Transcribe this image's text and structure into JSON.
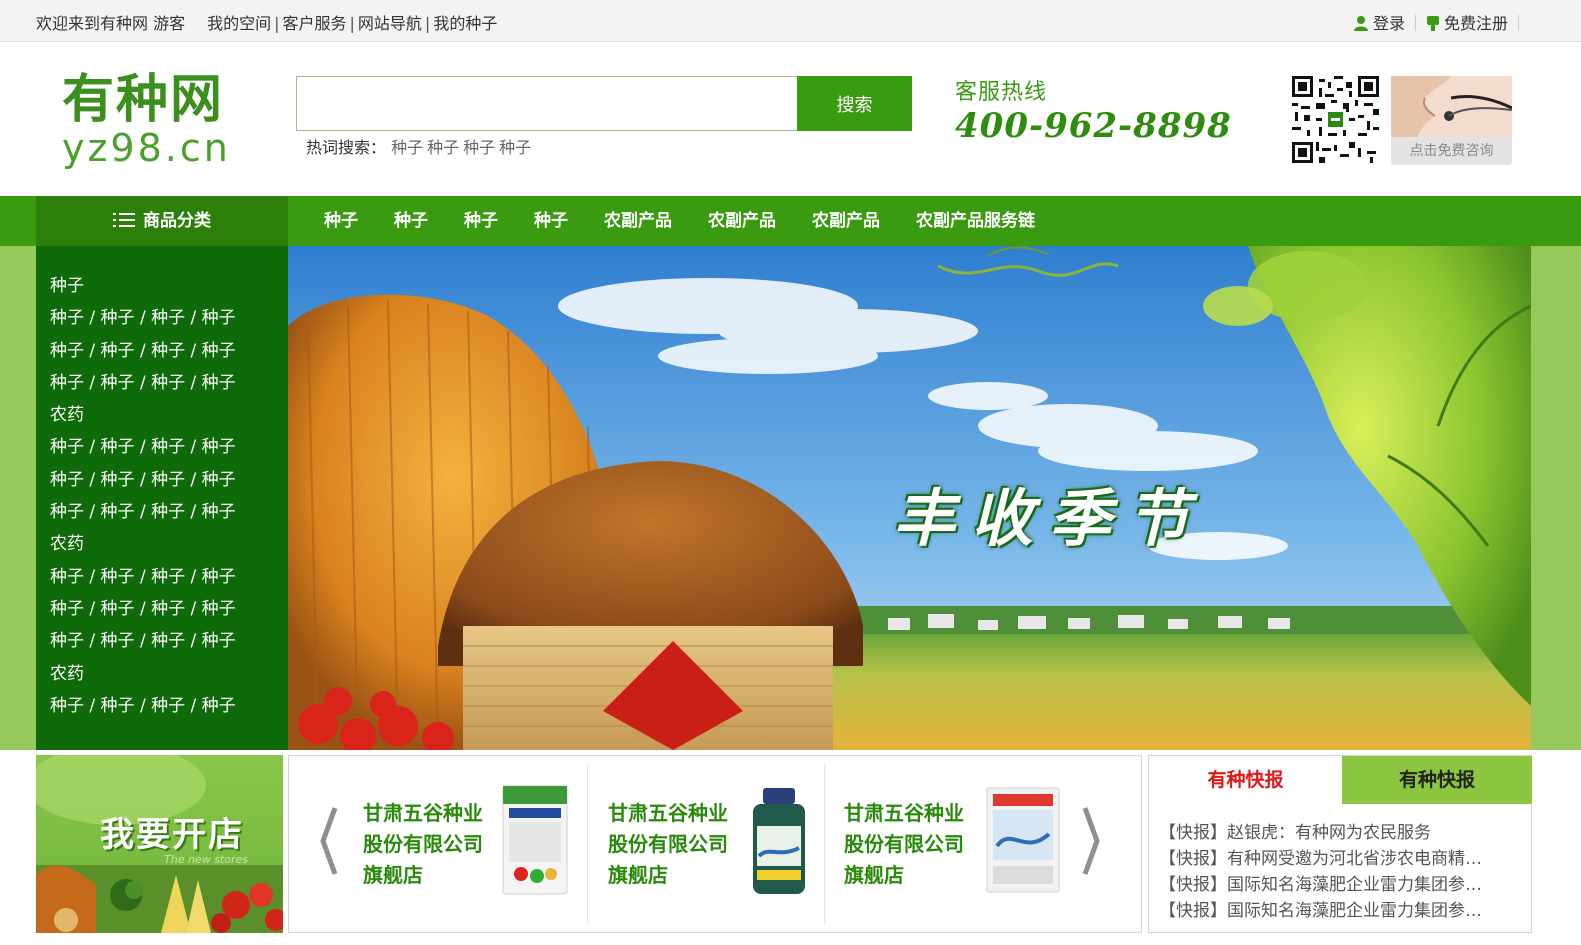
{
  "topbar": {
    "welcome": "欢迎来到有种网 游客",
    "links": [
      "我的空间",
      "客户服务",
      "网站导航",
      "我的种子"
    ],
    "login": "登录",
    "register": "免费注册"
  },
  "logo": {
    "cn": "有种网",
    "en": "yz98.cn"
  },
  "search": {
    "placeholder": "",
    "button": "搜索",
    "hot_label": "热词搜索：",
    "hot_words": [
      "种子",
      "种子",
      "种子",
      "种子"
    ]
  },
  "hotline": {
    "label": "客服热线",
    "number": "400-962-8898"
  },
  "consult": {
    "button": "点击免费咨询"
  },
  "nav": {
    "category_label": "商品分类",
    "items": [
      "种子",
      "种子",
      "种子",
      "种子",
      "农副产品",
      "农副产品",
      "农副产品",
      "农副产品服务链"
    ]
  },
  "sidebar": {
    "rows": [
      "种子",
      "种子 / 种子 / 种子 / 种子",
      "种子 / 种子 / 种子 / 种子",
      "种子 / 种子 / 种子 / 种子",
      "农药",
      "种子 / 种子 / 种子 / 种子",
      "种子 / 种子 / 种子 / 种子",
      "种子 / 种子 / 种子 / 种子",
      "农药",
      "种子 / 种子 / 种子 / 种子",
      "种子 / 种子 / 种子 / 种子",
      "种子 / 种子 / 种子 / 种子",
      "农药",
      "种子 / 种子 / 种子 / 种子"
    ]
  },
  "banner": {
    "slogan": "丰收季节"
  },
  "openstore": {
    "title": "我要开店",
    "subtitle": "The new stores"
  },
  "products": [
    {
      "name": "甘肃五谷种业股份有限公司旗舰店"
    },
    {
      "name": "甘肃五谷种业股份有限公司旗舰店"
    },
    {
      "name": "甘肃五谷种业股份有限公司旗舰店"
    }
  ],
  "news": {
    "tab_active": "有种快报",
    "tab_other": "有种快报",
    "items": [
      "【快报】赵银虎：有种网为农民服务",
      "【快报】有种网受邀为河北省涉农电商精准扶贫",
      "【快报】国际知名海藻肥企业雷力集团参观有种网",
      "【快报】国际知名海藻肥企业雷力集团参观有种网"
    ]
  },
  "colors": {
    "brand_green": "#3a9a10",
    "dark_green": "#0f6b0a",
    "news_active": "#e01818",
    "tab_green": "#8cc63e"
  }
}
